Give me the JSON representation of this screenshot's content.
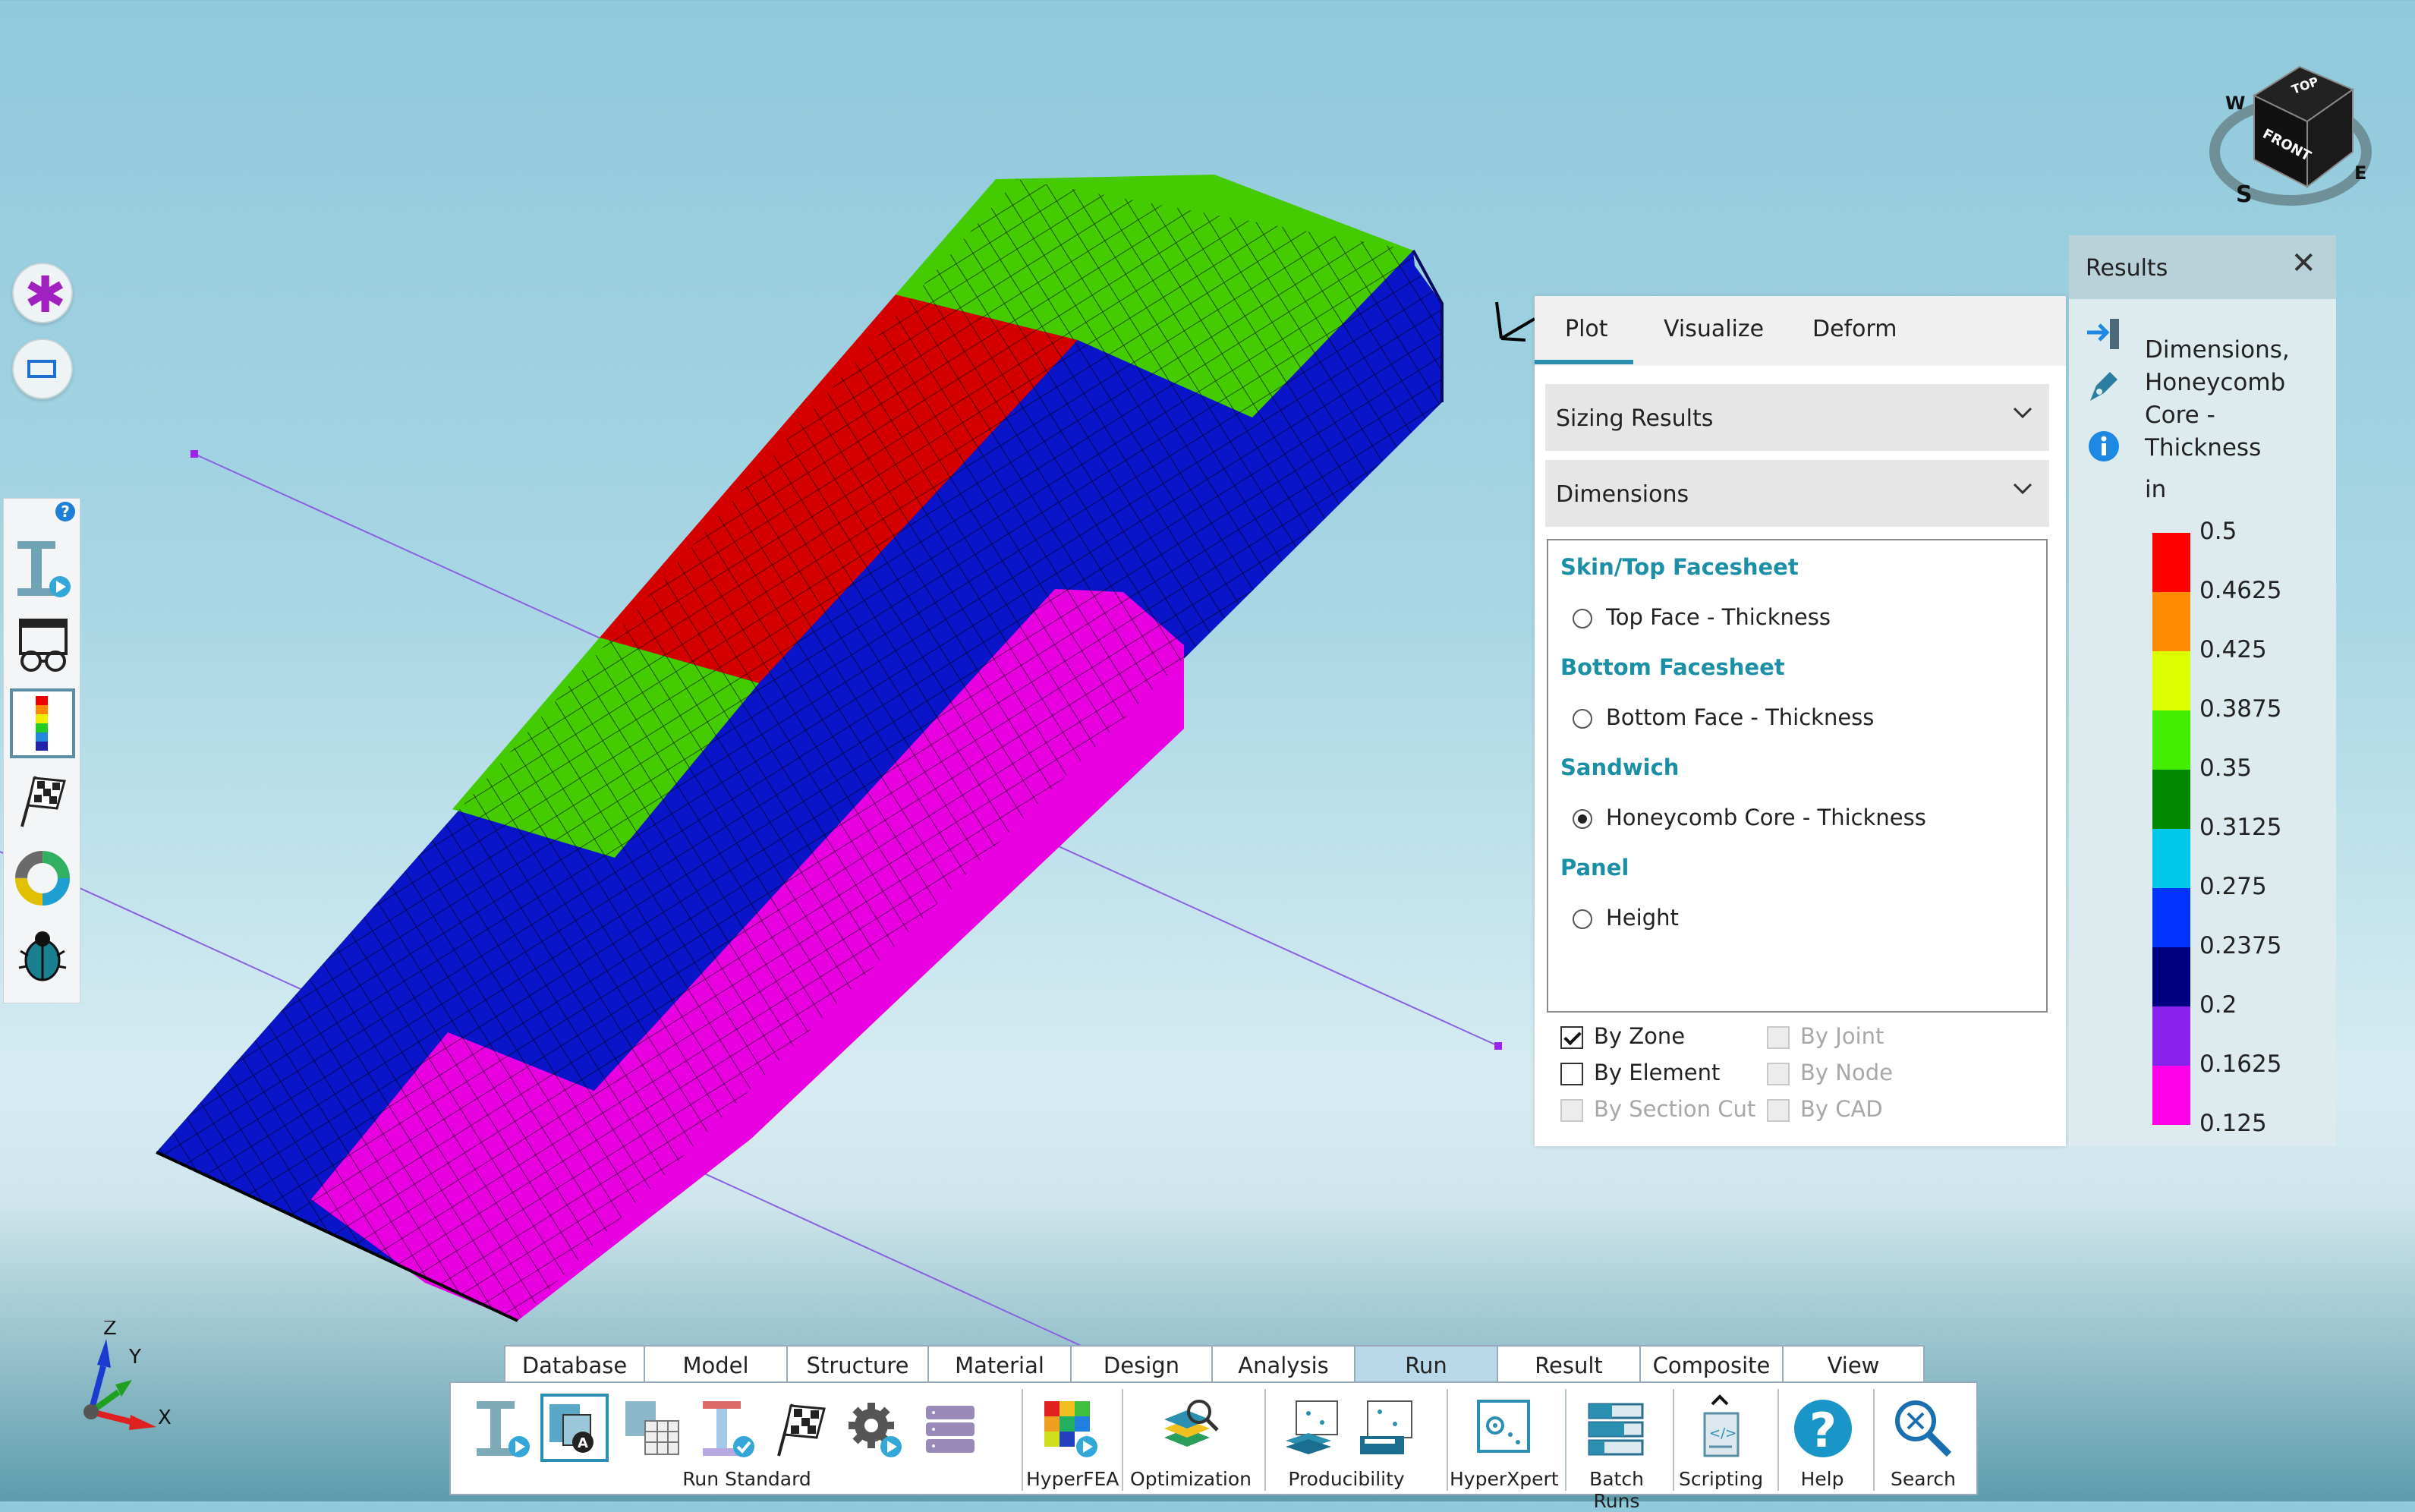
{
  "plot_panel": {
    "tabs": [
      "Plot",
      "Visualize",
      "Deform"
    ],
    "active_tab": "Plot",
    "dropdown_category": "Sizing Results",
    "dropdown_subcategory": "Dimensions",
    "groups": [
      {
        "title": "Skin/Top Facesheet",
        "option": "Top Face - Thickness",
        "selected": false
      },
      {
        "title": "Bottom Facesheet",
        "option": "Bottom Face - Thickness",
        "selected": false
      },
      {
        "title": "Sandwich",
        "option": "Honeycomb Core - Thickness",
        "selected": true
      },
      {
        "title": "Panel",
        "option": "Height",
        "selected": false
      }
    ],
    "checks": {
      "by_zone": {
        "label": "By Zone",
        "checked": true,
        "enabled": true
      },
      "by_element": {
        "label": "By Element",
        "checked": false,
        "enabled": true
      },
      "by_section_cut": {
        "label": "By Section Cut",
        "checked": false,
        "enabled": false
      },
      "by_joint": {
        "label": "By Joint",
        "checked": false,
        "enabled": false
      },
      "by_node": {
        "label": "By Node",
        "checked": false,
        "enabled": false
      },
      "by_cad": {
        "label": "By CAD",
        "checked": false,
        "enabled": false
      }
    }
  },
  "results_panel": {
    "title": "Results",
    "close_icon": "close-icon",
    "desc_lines": [
      "Dimensions,",
      "Honeycomb",
      "Core -",
      "Thickness"
    ],
    "unit": "in",
    "legend": [
      {
        "value": "0.5",
        "color": "#ff0000"
      },
      {
        "value": "0.4625",
        "color": "#ff8c00"
      },
      {
        "value": "0.425",
        "color": "#d9ff00"
      },
      {
        "value": "0.3875",
        "color": "#44ee00"
      },
      {
        "value": "0.35",
        "color": "#008800"
      },
      {
        "value": "0.3125",
        "color": "#00c8e8"
      },
      {
        "value": "0.275",
        "color": "#0033ff"
      },
      {
        "value": "0.2375",
        "color": "#000080"
      },
      {
        "value": "0.2",
        "color": "#8a22ee"
      },
      {
        "value": "0.1625",
        "color": "#ff00e8"
      },
      {
        "value": "0.125",
        "color": ""
      }
    ]
  },
  "ribbon": {
    "tabs": [
      "Database",
      "Model",
      "Structure",
      "Material",
      "Design",
      "Analysis",
      "Run",
      "Result",
      "Composite",
      "View"
    ],
    "active_tab": "Run",
    "groups": {
      "run_standard": "Run Standard",
      "hyperfea": "HyperFEA",
      "optimization": "Optimization",
      "producibility": "Producibility",
      "hyperxpert": "HyperXpert",
      "batch_runs": "Batch Runs",
      "scripting": "Scripting",
      "help": "Help",
      "search": "Search"
    }
  },
  "view_cube": {
    "faces": [
      "TOP",
      "FRONT"
    ],
    "compass": [
      "W",
      "S",
      "E"
    ]
  },
  "triad": {
    "x": "X",
    "y": "Y",
    "z": "Z"
  },
  "colors": {
    "accent": "#1a8fa6",
    "red_zone": "#d40000",
    "green_zone": "#44cc00",
    "blue_zone": "#0a14c8",
    "magenta_zone": "#e800e0"
  }
}
